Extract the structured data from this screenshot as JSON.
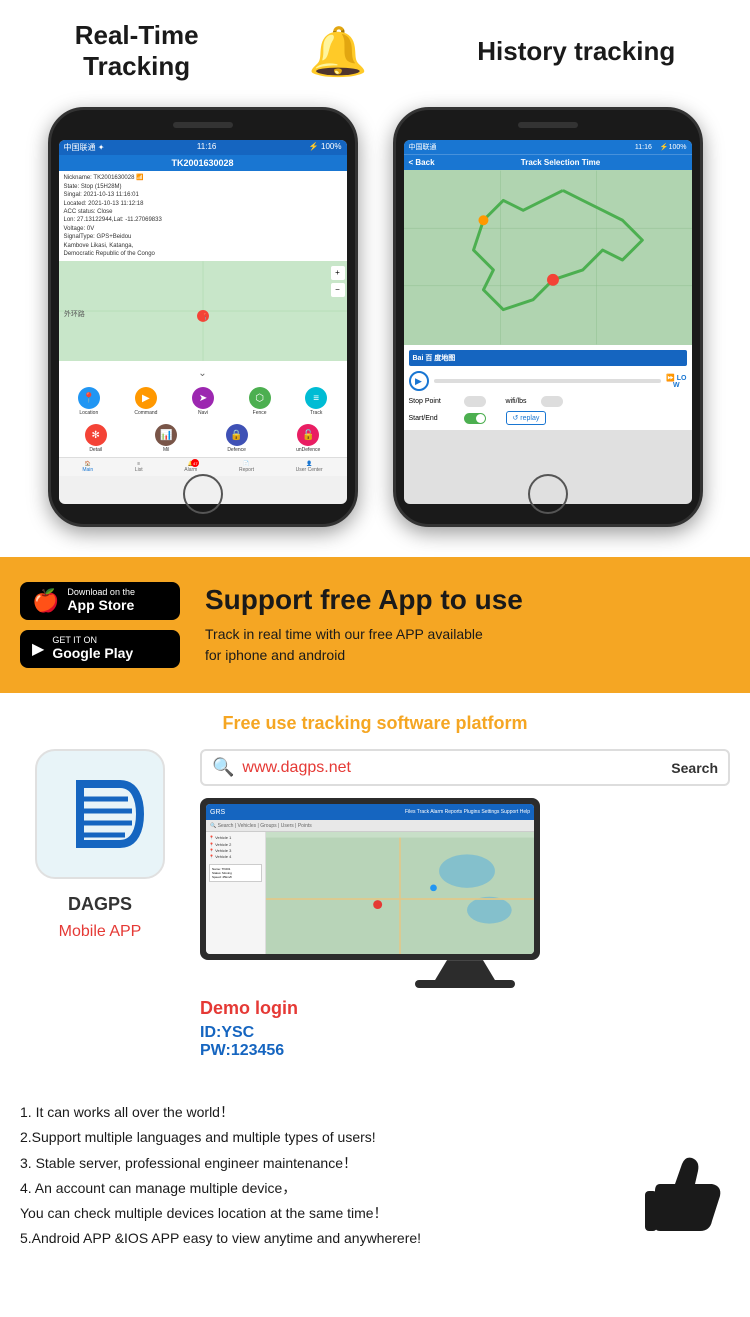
{
  "header": {
    "feature1": "Real-Time\nTracking",
    "feature2": "History tracking",
    "bell_icon": "🔔"
  },
  "app_section": {
    "appstore_label_small": "Download on the",
    "appstore_label_large": "App Store",
    "googleplay_label_small": "GET IT ON",
    "googleplay_label_large": "Google Play",
    "support_title": "Support free App to use",
    "support_desc": "Track in real time with our free APP available\nfor iphone and android"
  },
  "platform": {
    "title": "Free use tracking software platform",
    "app_name": "DAGPS",
    "mobile_app_label": "Mobile APP",
    "search_url": "www.dagps.net",
    "search_placeholder": "Search",
    "search_btn_label": "Search",
    "demo_login": "Demo login",
    "demo_id": "ID:YSC",
    "demo_pw": "PW:123456"
  },
  "phone1": {
    "status": "中国联通 ✦",
    "time": "11:16",
    "device_id": "TK2001630028",
    "info_lines": [
      "Nickname: TK2001630028",
      "State: Stop (15H28M)",
      "Singal: 2021-10-13 11:16:01",
      "Located: 2021-10-13 11:12:18",
      "ACC status: Close",
      "Lon: 27.13122944,Lat:",
      "-11.27069833",
      "Voltage: 0V",
      "SignalType: GPS+Beidou",
      "Kambove Likasi, Katanga,",
      "Democratic Republic of the Congo"
    ],
    "icons": [
      {
        "label": "Location",
        "color": "#2196f3"
      },
      {
        "label": "Command",
        "color": "#ff9800"
      },
      {
        "label": "Navi",
        "color": "#9c27b0"
      },
      {
        "label": "Fence",
        "color": "#4caf50"
      },
      {
        "label": "Track",
        "color": "#00bcd4"
      }
    ],
    "icons2": [
      {
        "label": "Detail",
        "color": "#f44336"
      },
      {
        "label": "Mil",
        "color": "#795548"
      },
      {
        "label": "Defence",
        "color": "#3f51b5"
      },
      {
        "label": "unDefence",
        "color": "#e91e63"
      }
    ],
    "nav": [
      "Main",
      "List",
      "Alarm",
      "Report",
      "User Center"
    ]
  },
  "phone2": {
    "back_label": "< Back",
    "title": "Track Selection Time",
    "stop_point_label": "Stop Point",
    "wifi_lbs_label": "wifi/lbs",
    "start_end_label": "Start/End",
    "replay_label": "↺ replay",
    "speed_label": "LO\nW"
  },
  "features": [
    "1. It can works all over the world！",
    "2.Support multiple languages and multiple types of users!",
    "3. Stable server, professional engineer maintenance！",
    "4. An account can manage multiple device，",
    "You can check multiple devices location at the same time！",
    "5.Android APP &IOS APP easy to view anytime and anywherere!"
  ]
}
